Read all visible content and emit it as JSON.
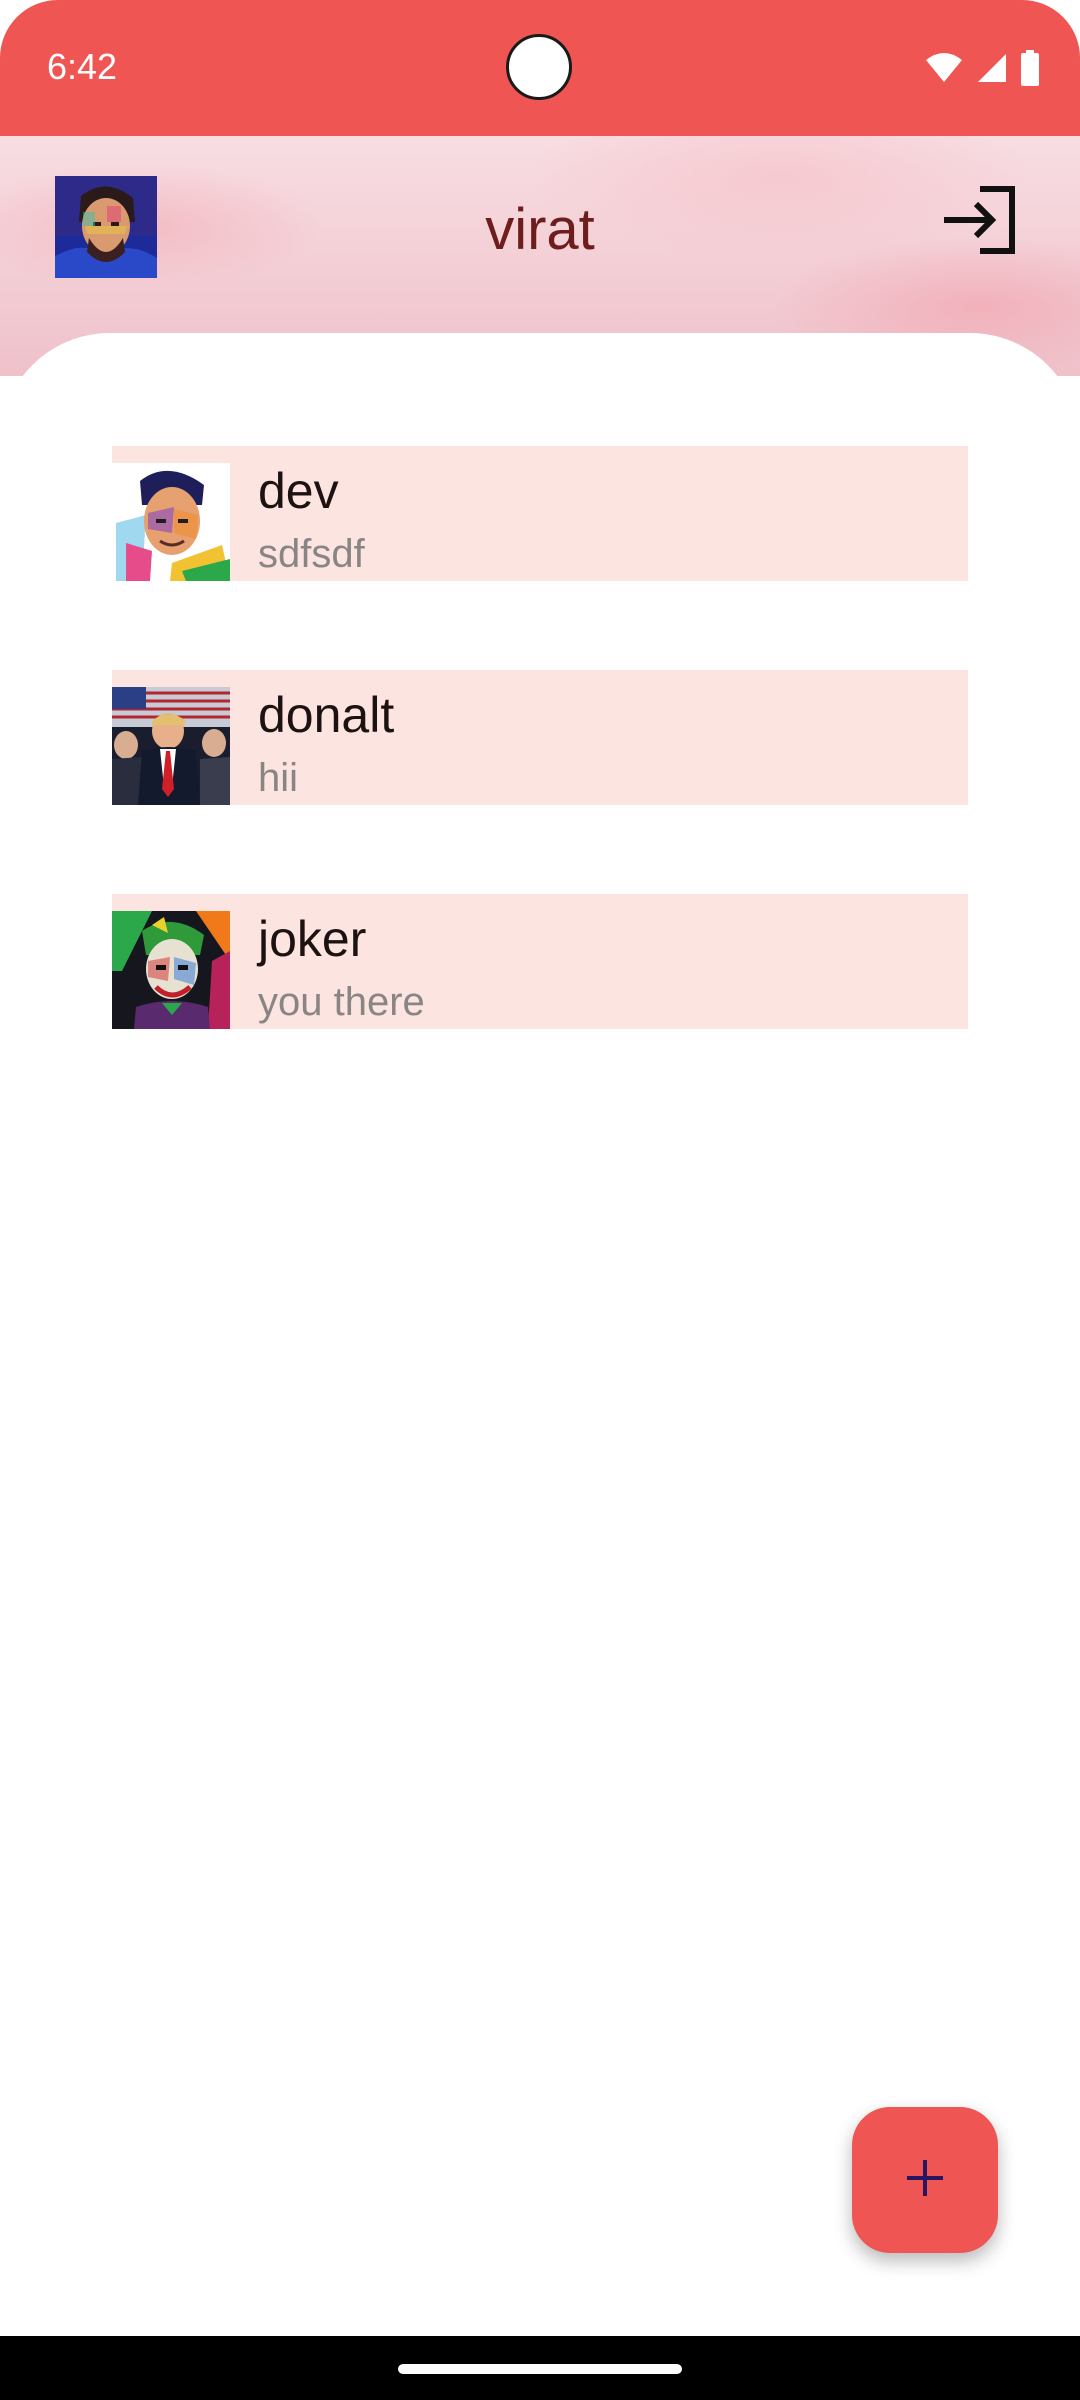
{
  "status_bar": {
    "time": "6:42",
    "icons": [
      "wifi-icon",
      "signal-icon",
      "battery-icon"
    ],
    "color": "#ef5552"
  },
  "header": {
    "title": "virat",
    "avatar_icon": "user-avatar",
    "logout_icon": "login-arrow-icon"
  },
  "chats": [
    {
      "name": "dev",
      "last_message": "sdfsdf",
      "avatar_icon": "avatar-dev"
    },
    {
      "name": "donalt",
      "last_message": "hii",
      "avatar_icon": "avatar-donalt"
    },
    {
      "name": "joker",
      "last_message": "you there",
      "avatar_icon": "avatar-joker"
    }
  ],
  "fab": {
    "icon": "plus-icon",
    "color": "#ef5552"
  },
  "colors": {
    "accent": "#ef5552",
    "title_text": "#6e1d1d",
    "chat_item_bg": "#fce4e0"
  }
}
